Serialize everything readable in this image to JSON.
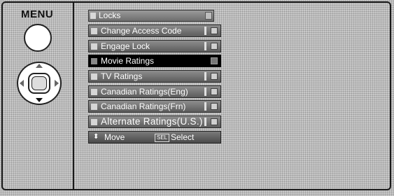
{
  "remote": {
    "menu_label": "MENU"
  },
  "osd": {
    "title": "Locks",
    "items": [
      {
        "label": "Change Access Code",
        "selected": false
      },
      {
        "label": "Engage Lock",
        "selected": false
      },
      {
        "label": "Movie Ratings",
        "selected": true
      },
      {
        "label": "TV Ratings",
        "selected": false
      },
      {
        "label": "Canadian Ratings(Eng)",
        "selected": false
      },
      {
        "label": "Canadian Ratings(Frn)",
        "selected": false
      },
      {
        "label": "Alternate Ratings(U.S.)",
        "selected": false
      }
    ],
    "footer": {
      "updown_icon": "⬍",
      "move_label": "Move",
      "sel_key": "SEL",
      "select_label": "Select"
    }
  }
}
